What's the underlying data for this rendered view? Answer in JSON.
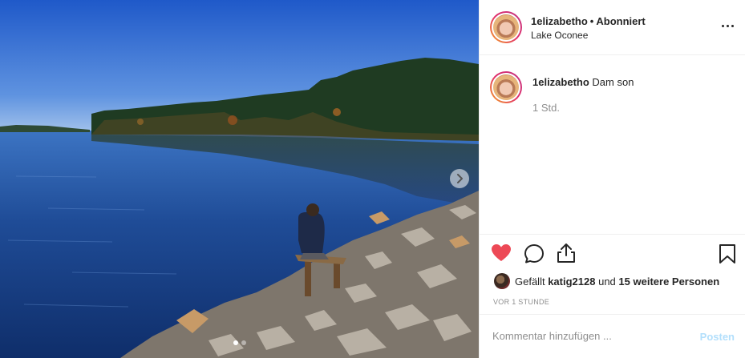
{
  "photo": {
    "description_icon": "lake-photo",
    "next_icon": "chevron-right-icon",
    "carousel_dots": 2,
    "active_dot": 0
  },
  "header": {
    "username": "1elizabetho",
    "separator": "•",
    "follow_status": "Abonniert",
    "location": "Lake Oconee",
    "more_icon": "more-options-icon"
  },
  "comment": {
    "username": "1elizabetho",
    "text": "Dam son",
    "time": "1 Std."
  },
  "actions": {
    "like_icon": "heart-icon",
    "like_color": "#ed4956",
    "comment_icon": "comment-bubble-icon",
    "share_icon": "share-icon",
    "save_icon": "bookmark-icon"
  },
  "likes": {
    "prefix": "Gefällt",
    "user": "katig2128",
    "middle": "und",
    "others": "15 weitere Personen"
  },
  "posted_ago": "VOR 1 STUNDE",
  "add_comment": {
    "placeholder": "Kommentar hinzufügen ...",
    "post_label": "Posten",
    "post_color": "#b2dffc"
  }
}
